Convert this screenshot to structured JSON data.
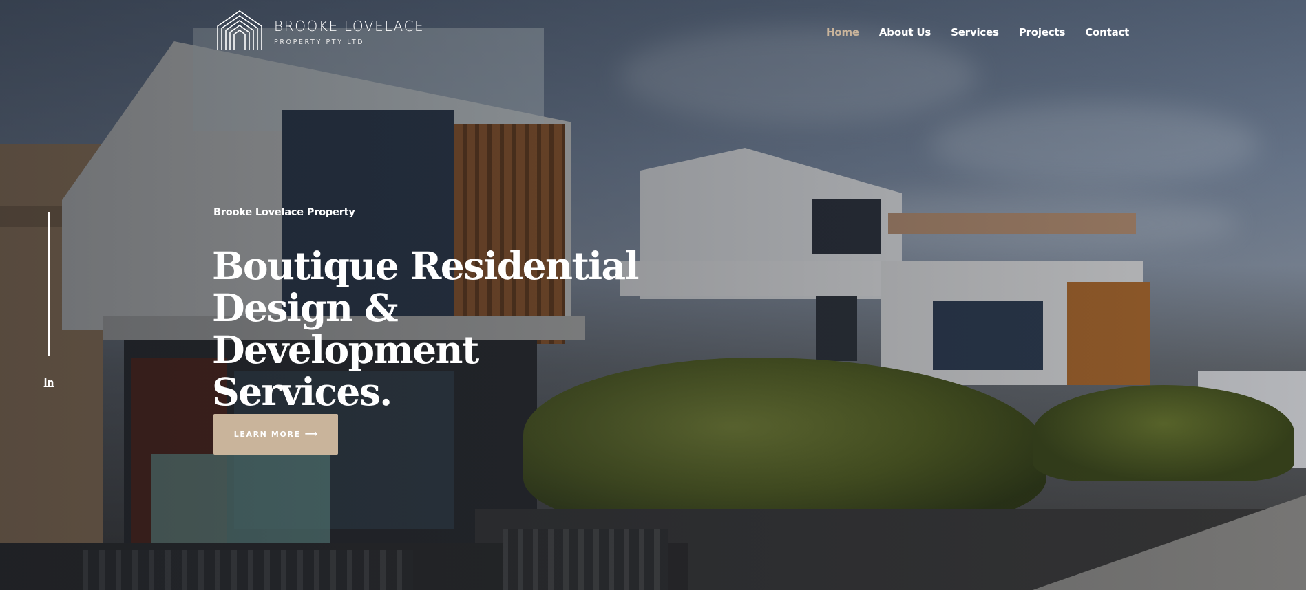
{
  "brand": {
    "name": "BROOKE LOVELACE",
    "subtitle": "PROPERTY PTY LTD",
    "logo_icon": "house-arches-icon"
  },
  "nav": {
    "items": [
      {
        "label": "Home",
        "active": true
      },
      {
        "label": "About Us",
        "active": false
      },
      {
        "label": "Services",
        "active": false
      },
      {
        "label": "Projects",
        "active": false
      },
      {
        "label": "Contact",
        "active": false
      }
    ]
  },
  "social": {
    "icon": "linkedin-icon",
    "glyph": "in"
  },
  "hero": {
    "eyebrow": "Brooke Lovelace Property",
    "headline": "Boutique Residential Design & Development Services.",
    "cta_label": "LEARN MORE",
    "cta_arrow": "⟶"
  },
  "colors": {
    "accent": "#c9b49b",
    "text": "#ffffff"
  }
}
